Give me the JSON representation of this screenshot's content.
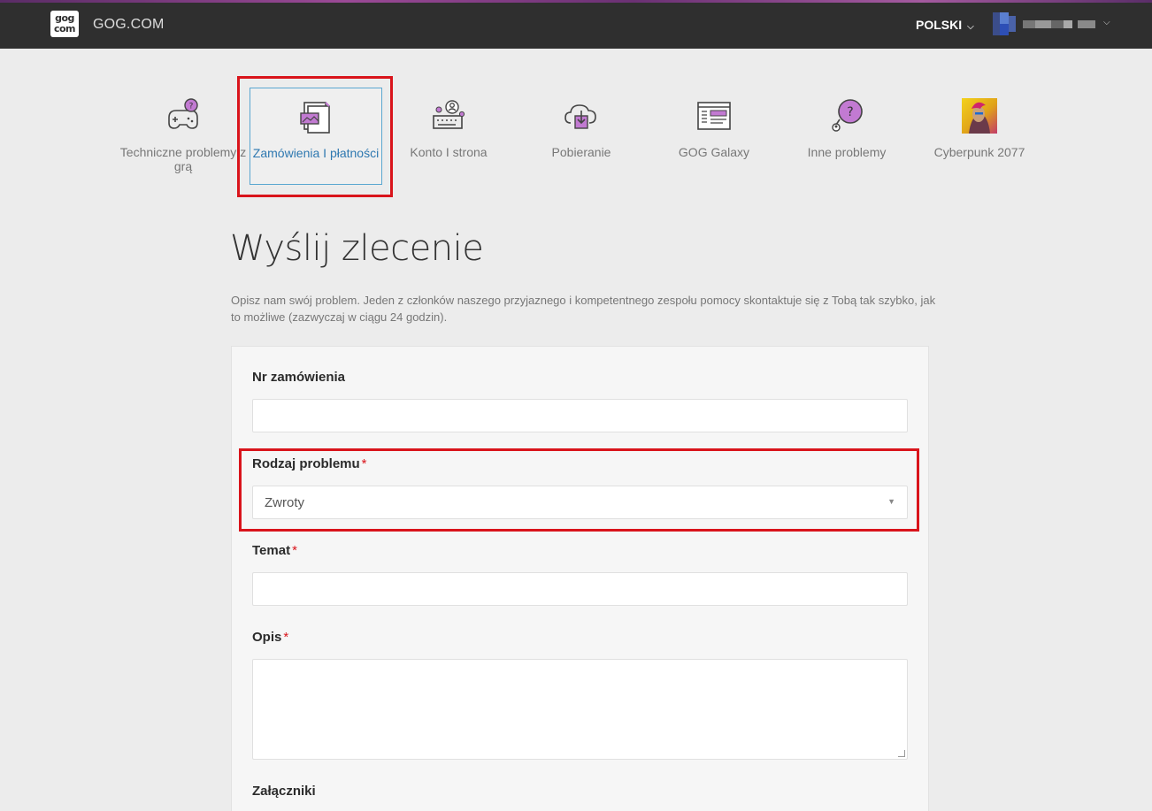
{
  "header": {
    "logo_top": "gog",
    "logo_bottom": "com",
    "brand": "GOG.COM",
    "language": "POLSKI"
  },
  "categories": [
    {
      "label": "Techniczne problemy z grą",
      "icon": "gamepad-question-icon"
    },
    {
      "label": "Zamówienia I płatności",
      "icon": "orders-payment-icon",
      "active": true
    },
    {
      "label": "Konto I strona",
      "icon": "account-keyboard-icon"
    },
    {
      "label": "Pobieranie",
      "icon": "cloud-download-icon"
    },
    {
      "label": "GOG Galaxy",
      "icon": "galaxy-window-icon"
    },
    {
      "label": "Inne problemy",
      "icon": "question-bubble-icon"
    },
    {
      "label": "Cyberpunk 2077",
      "icon": "cyberpunk-thumbnail"
    }
  ],
  "page": {
    "title": "Wyślij zlecenie",
    "description": "Opisz nam swój problem. Jeden z członków naszego przyjaznego i kompetentnego zespołu pomocy skontaktuje się z Tobą tak szybko, jak to możliwe (zazwyczaj w ciągu 24 godzin)."
  },
  "form": {
    "order_label": "Nr zamówienia",
    "order_value": "",
    "problem_label": "Rodzaj problemu",
    "problem_value": "Zwroty",
    "subject_label": "Temat",
    "subject_value": "",
    "description_label": "Opis",
    "description_value": "",
    "attachments_label": "Załączniki",
    "required_mark": "*"
  },
  "colors": {
    "accent_purple": "#c27ad2",
    "highlight_red": "#d9141b",
    "active_blue": "#2e78b0"
  }
}
